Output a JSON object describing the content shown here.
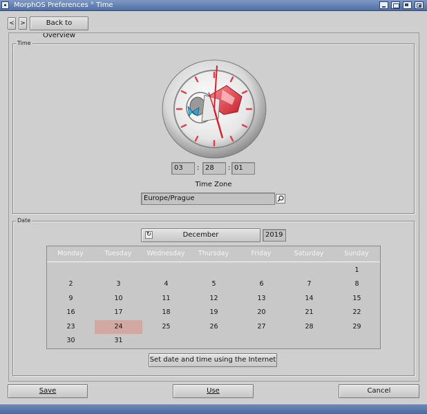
{
  "window": {
    "title": "MorphOS Preferences ° Time"
  },
  "nav": {
    "prev_label": "<",
    "next_label": ">",
    "back_label": "Back to Overview"
  },
  "time_group": {
    "legend": "Time",
    "hours": "03",
    "minutes": "28",
    "seconds": "01",
    "separator": ":",
    "timezone_label": "Time Zone",
    "timezone_value": "Europe/Prague"
  },
  "date_group": {
    "legend": "Date",
    "month": "December",
    "year": "2019",
    "weekdays": [
      "Monday",
      "Tuesday",
      "Wednesday",
      "Thursday",
      "Friday",
      "Saturday",
      "Sunday"
    ],
    "weeks": [
      [
        "",
        "",
        "",
        "",
        "",
        "",
        "1"
      ],
      [
        "2",
        "3",
        "4",
        "5",
        "6",
        "7",
        "8"
      ],
      [
        "9",
        "10",
        "11",
        "12",
        "13",
        "14",
        "15"
      ],
      [
        "16",
        "17",
        "18",
        "19",
        "20",
        "21",
        "22"
      ],
      [
        "23",
        "24",
        "25",
        "26",
        "27",
        "28",
        "29"
      ],
      [
        "30",
        "31",
        "",
        "",
        "",
        "",
        ""
      ]
    ],
    "selected_day": "24",
    "internet_button": "Set date and time using the Internet"
  },
  "actions": {
    "save": "Save",
    "use": "Use",
    "cancel": "Cancel"
  },
  "colors": {
    "selected_day": "#d2a9a2",
    "titlebar": "#5f7db1",
    "window_bg": "#cfcfcf"
  }
}
